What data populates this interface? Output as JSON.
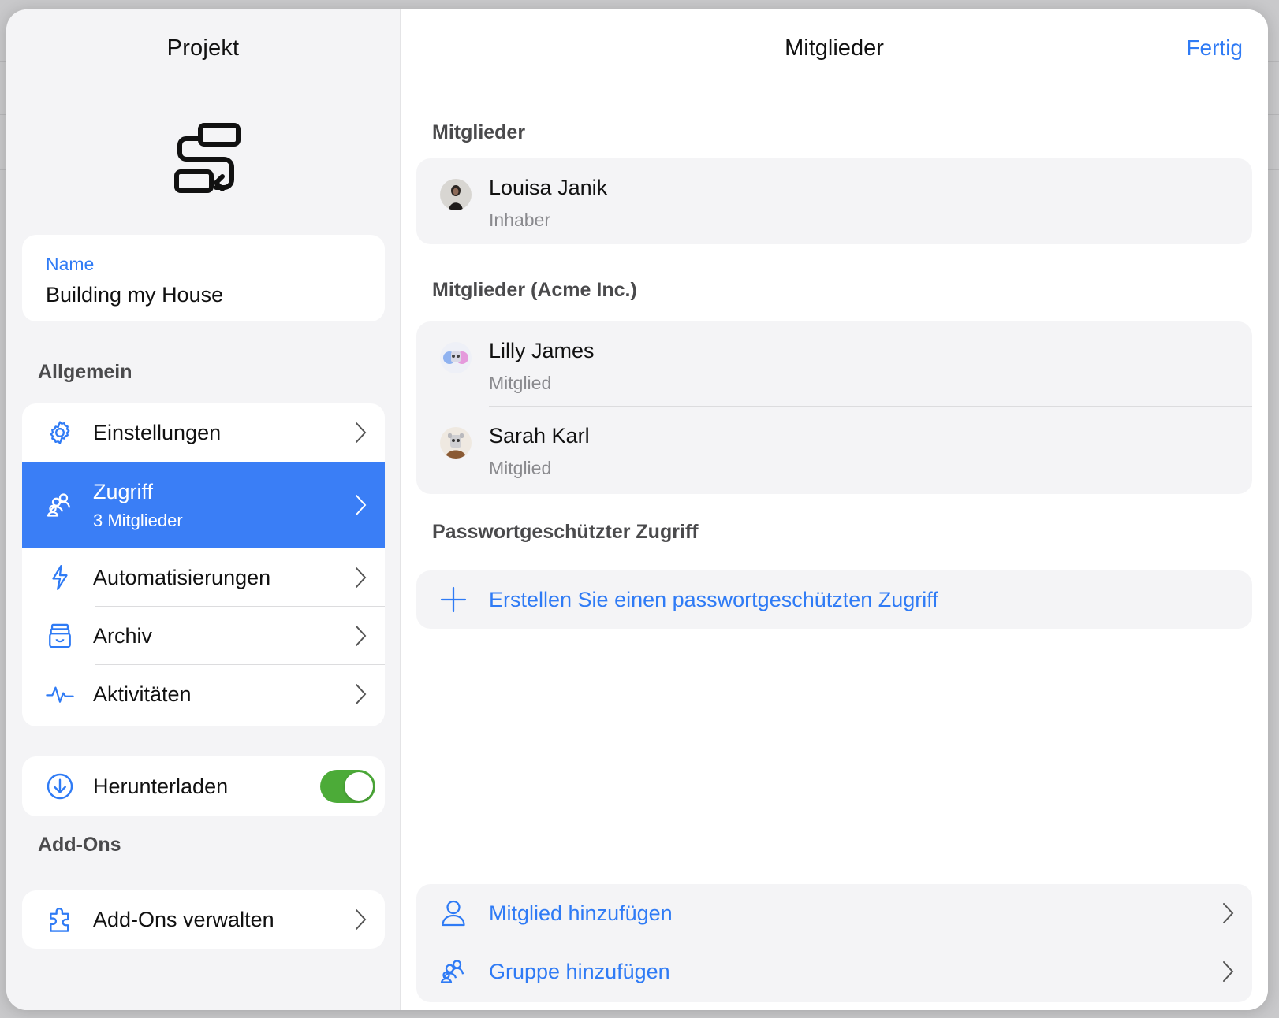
{
  "left": {
    "title": "Projekt",
    "name_label": "Name",
    "name_value": "Building my House",
    "general_heading": "Allgemein",
    "items": [
      {
        "label": "Einstellungen",
        "icon": "gear-icon"
      },
      {
        "label": "Zugriff",
        "sub": "3 Mitglieder",
        "icon": "group-icon"
      },
      {
        "label": "Automatisierungen",
        "icon": "bolt-icon"
      },
      {
        "label": "Archiv",
        "icon": "archive-icon"
      },
      {
        "label": "Aktivitäten",
        "icon": "activity-icon"
      }
    ],
    "download_label": "Herunterladen",
    "download_enabled": true,
    "addons_heading": "Add-Ons",
    "addons_label": "Add-Ons verwalten"
  },
  "right": {
    "title": "Mitglieder",
    "done_label": "Fertig",
    "owners_heading": "Mitglieder",
    "owner": {
      "name": "Louisa Janik",
      "role": "Inhaber"
    },
    "acme_heading": "Mitglieder (Acme Inc.)",
    "acme_members": [
      {
        "name": "Lilly James",
        "role": "Mitglied"
      },
      {
        "name": "Sarah Karl",
        "role": "Mitglied"
      }
    ],
    "pw_heading": "Passwortgeschützter Zugriff",
    "pw_create_label": "Erstellen Sie einen passwortgeschützten Zugriff",
    "add_member_label": "Mitglied hinzufügen",
    "add_group_label": "Gruppe hinzufügen"
  },
  "colors": {
    "accent": "#2f7bf5",
    "selected_bg": "#3a7ef6",
    "toggle_on": "#4cab38"
  }
}
